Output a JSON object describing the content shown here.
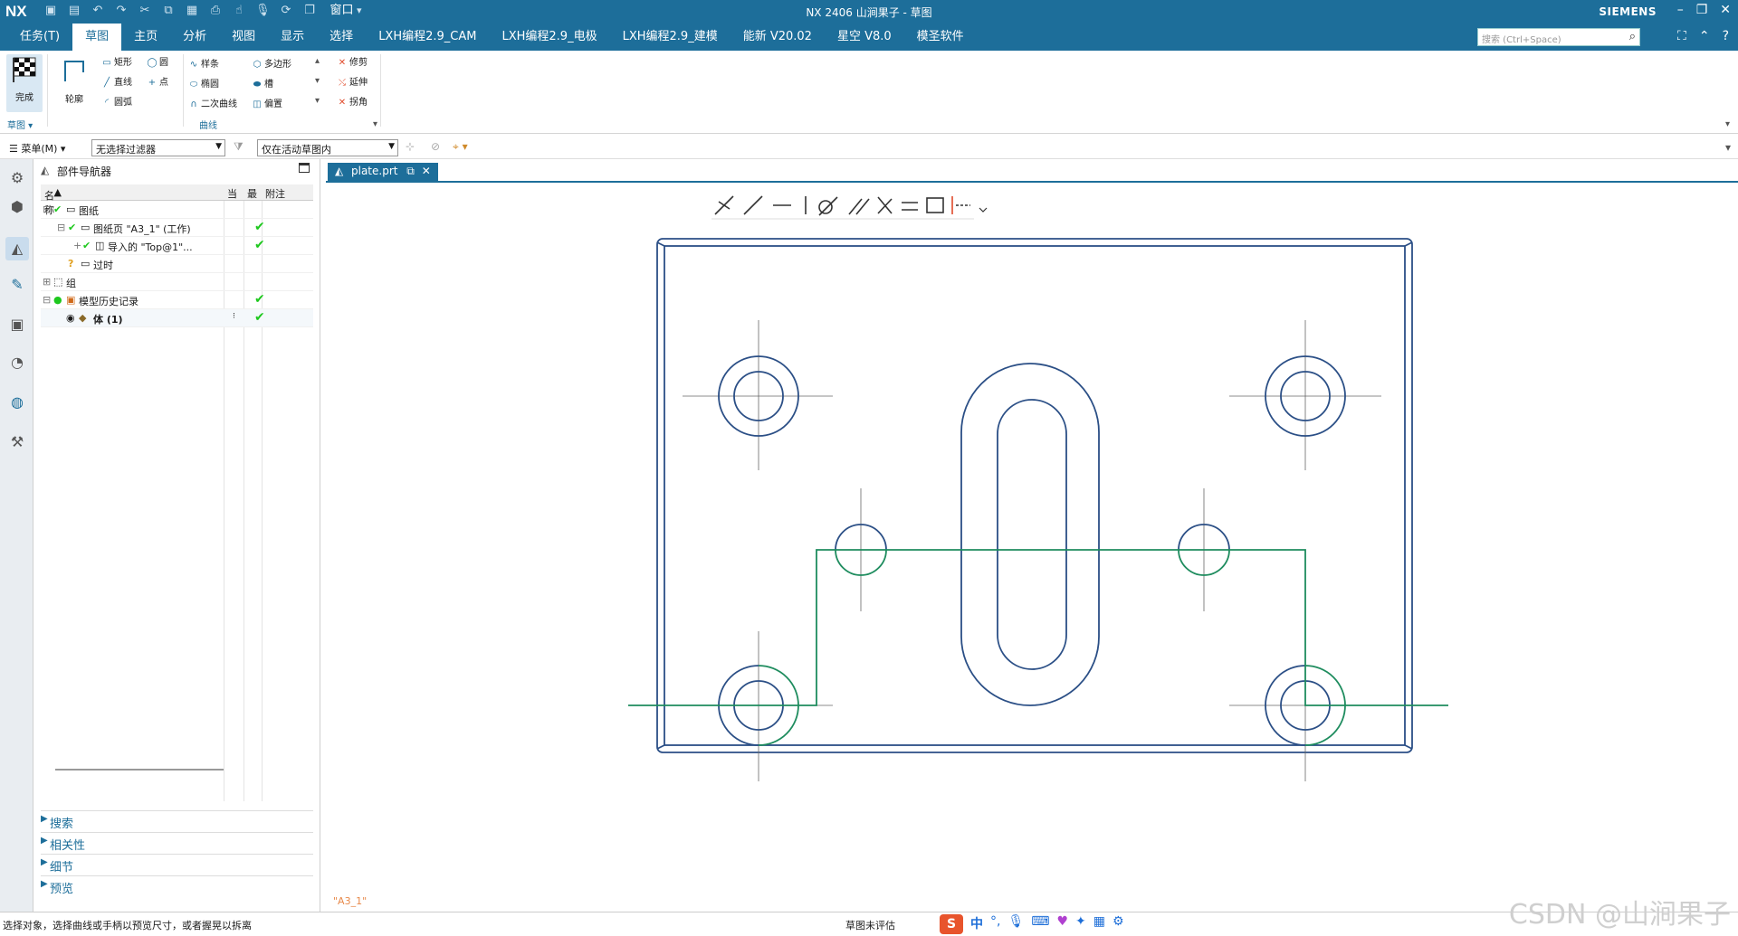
{
  "window": {
    "app_logo": "NX",
    "title": "NX 2406 山涧果子 - 草图",
    "brand": "SIEMENS",
    "qa_window_label": "窗口"
  },
  "menubar": {
    "tabs": [
      "任务(T)",
      "草图",
      "主页",
      "分析",
      "视图",
      "显示",
      "选择",
      "LXH编程2.9_CAM",
      "LXH编程2.9_电极",
      "LXH编程2.9_建模",
      "能新 V20.02",
      "星空 V8.0",
      "模圣软件"
    ],
    "active_tab": "草图",
    "search_placeholder": "搜索 (Ctrl+Space)"
  },
  "ribbon": {
    "finish": "完成",
    "group_sketch": "草图",
    "profile": "轮廓",
    "rect": "矩形",
    "line": "直线",
    "arc": "圆弧",
    "circle": "圆",
    "point": "点",
    "spline": "样条",
    "ellipse": "椭圆",
    "conic": "二次曲线",
    "polygon": "多边形",
    "slot": "槽",
    "offset": "偏置",
    "trim": "修剪",
    "extend": "延伸",
    "corner": "拐角",
    "group_curve": "曲线"
  },
  "toolbar2": {
    "menu": "菜单(M)",
    "filter": "无选择过滤器",
    "scope": "仅在活动草图内"
  },
  "navigator": {
    "title": "部件导航器",
    "col_name": "名称",
    "col_current": "当",
    "col_latest": "最",
    "col_note": "附注",
    "rows": [
      {
        "label": "图纸"
      },
      {
        "label": "图纸页 \"A3_1\" (工作)"
      },
      {
        "label": "导入的 \"Top@1\"..."
      },
      {
        "label": "过时"
      },
      {
        "label": "组"
      },
      {
        "label": "模型历史记录"
      },
      {
        "label": "体 (1)"
      }
    ],
    "sections": [
      "搜索",
      "相关性",
      "细节",
      "预览"
    ]
  },
  "document": {
    "tab": "plate.prt",
    "sheet_label": "\"A3_1\""
  },
  "status": {
    "message": "选择对象，选择曲线或手柄以预览尺寸，或者握晃以拆离",
    "sketch_state": "草图未评估",
    "ime_cn": "中"
  },
  "watermark": "CSDN @山涧果子",
  "colors": {
    "accent": "#1d6e9a",
    "drawing_blue": "#2b4f86",
    "section_green": "#1e8c5e",
    "check_green": "#1ec81e"
  }
}
